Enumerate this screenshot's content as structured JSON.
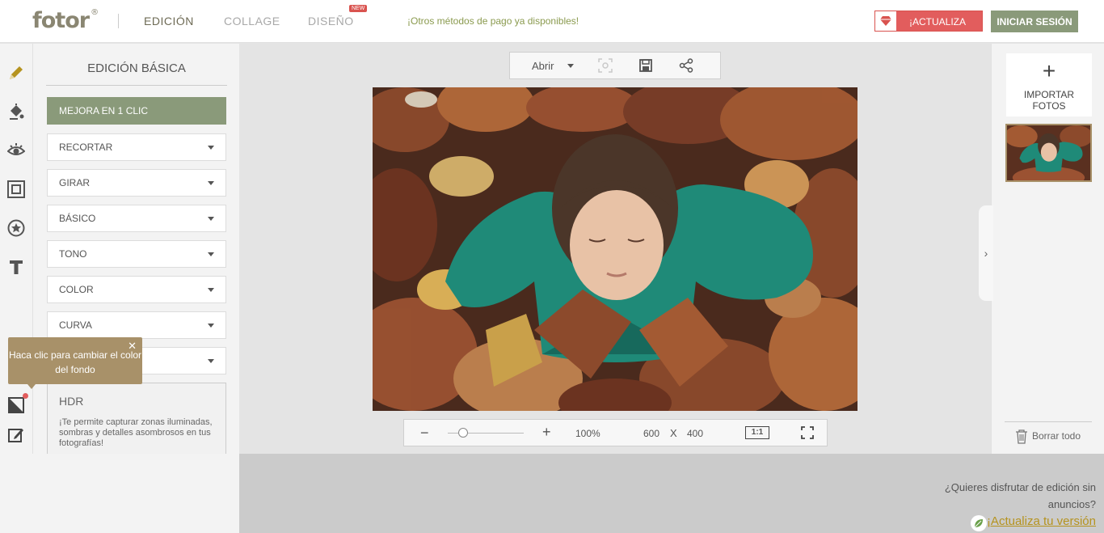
{
  "header": {
    "logo_text": "fotor",
    "logo_mark": "®",
    "nav": {
      "edit": "EDICIÓN",
      "collage": "COLLAGE",
      "design": "DISEÑO",
      "new_badge": "NEW"
    },
    "promo": "¡Otros métodos de pago ya disponibles!",
    "upgrade_label": "¡ACTUALIZA",
    "login_label": "INICIAR SESIÓN",
    "accent_color": "#8a9a7a",
    "upgrade_color": "#e25d5d"
  },
  "toolbar": {
    "tools": [
      "pencil-icon",
      "paint-bucket-icon",
      "eye-icon",
      "frame-icon",
      "star-icon",
      "text-icon",
      "background-icon",
      "edit-icon"
    ]
  },
  "panel": {
    "title": "EDICIÓN BÁSICA",
    "one_click": "MEJORA EN 1 CLIC",
    "dropdowns": [
      "RECORTAR",
      "GIRAR",
      "BÁSICO",
      "TONO",
      "COLOR",
      "CURVA",
      ""
    ],
    "hdr_title": "HDR",
    "hdr_desc": "¡Te permite capturar zonas iluminadas, sombras y detalles asombrosos en tus fotografías!"
  },
  "tooltip": {
    "text": "Haca clic para cambiar el color del fondo",
    "close": "✕"
  },
  "canvas": {
    "open_label": "Abrir",
    "zoom_minus": "−",
    "zoom_plus": "+",
    "zoom_level": 0.2,
    "zoom_percent": "100%",
    "width": "600",
    "times": "X",
    "height": "400",
    "one_to_one": "1:1"
  },
  "right_panel": {
    "import_plus": "+",
    "import_label": "IMPORTAR FOTOS",
    "collapse": "›",
    "clear_all": "Borrar todo"
  },
  "ad": {
    "question": "¿Quieres disfrutar de edición sin anuncios?",
    "link": "¡Actualiza tu versión"
  }
}
